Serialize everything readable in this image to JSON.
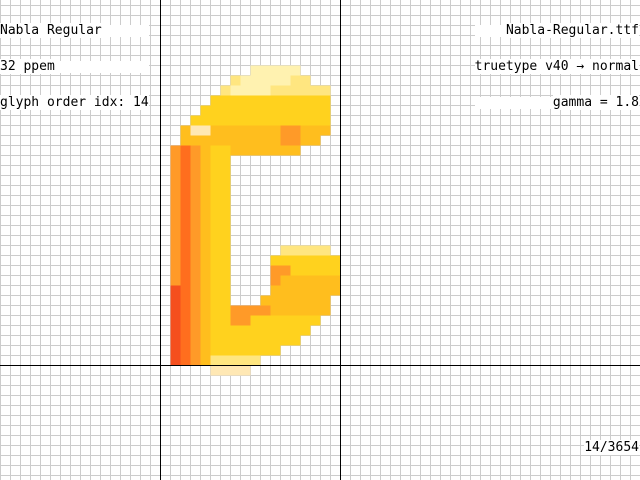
{
  "header_left": {
    "font_name": "Nabla Regular",
    "ppem": "32 ppem",
    "glyph_index": "glyph order idx: 14"
  },
  "header_right": {
    "file_name": "Nabla-Regular.ttf",
    "hinting": "truetype v40 → normal",
    "gamma": "gamma = 1.8"
  },
  "footer": {
    "glyph_counter": "14/3654"
  },
  "view": {
    "background_color": "#ffffff",
    "grid_color": "#cccccc",
    "axis_color": "#000000",
    "glyph_colors": {
      "highlight": "#fff2b0",
      "light": "#ffe680",
      "mid": "#ffd21e",
      "gold": "#ffbe1e",
      "orange": "#ff9a28",
      "deep_orange": "#ff6e1e",
      "red_orange": "#f54f1e",
      "pale": "#ffe8b4"
    }
  }
}
